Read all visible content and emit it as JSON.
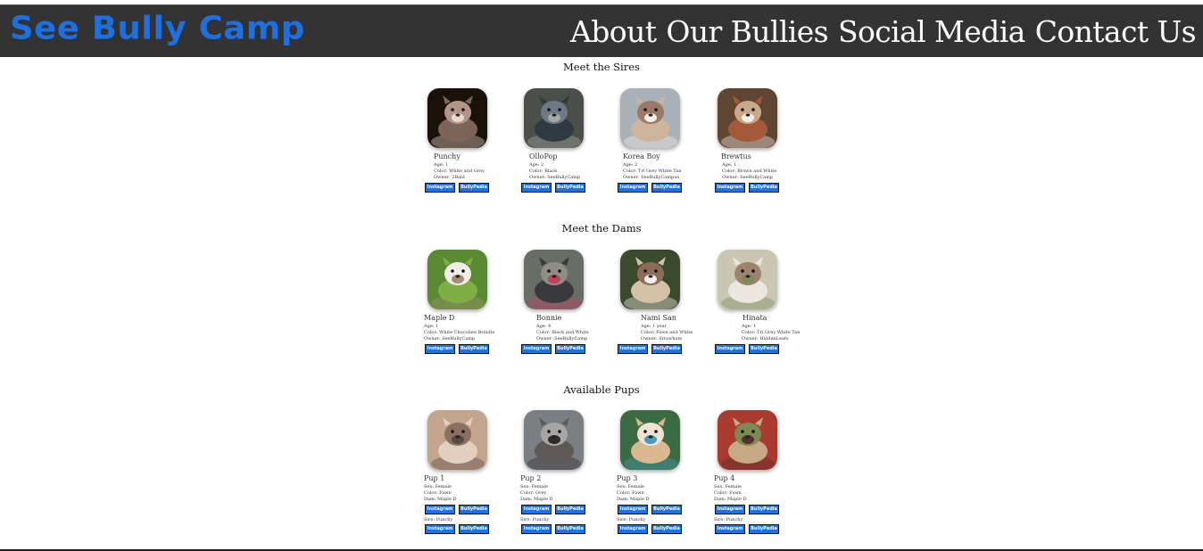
{
  "header": {
    "logo": "See Bully Camp",
    "nav": [
      "About",
      "Our Bullies",
      "Social Media",
      "Contact Us"
    ]
  },
  "sections": {
    "sires": {
      "title": "Meet the Sires",
      "dogs": [
        {
          "name": "Punchy",
          "lines": [
            "Age: 1",
            "Color: White and Grey",
            "Owner: 2Baid"
          ]
        },
        {
          "name": "OlloPop",
          "lines": [
            "Age: 2",
            "Color: Black",
            "Owner: SeeBullyCamp"
          ]
        },
        {
          "name": "Korea Boy",
          "lines": [
            "Age: 2",
            "Color: Tri Grey White Tan",
            "Owner: SeeBullyCampus"
          ]
        },
        {
          "name": "Brewtus",
          "lines": [
            "Age: 1",
            "Color: Brown and White",
            "Owner: SeeBullyCamp"
          ]
        }
      ]
    },
    "dams": {
      "title": "Meet the Dams",
      "dogs": [
        {
          "name": "Maple D",
          "lines": [
            "Age: 1",
            "Color: White Chocolate Brindle",
            "Owner: SeeBullyCamp"
          ]
        },
        {
          "name": "Bonnie",
          "lines": [
            "Age: 4",
            "Color: Black and White",
            "Owner: SeeBullyCamp"
          ]
        },
        {
          "name": "Nami San",
          "lines": [
            "Age: 1 year",
            "Color: Fawn and White",
            "Owner: Strawhats"
          ]
        },
        {
          "name": "Hinata",
          "lines": [
            "Age: 1",
            "Color: Tri Grey White Tan",
            "Owner: HiddenLeafs"
          ]
        }
      ]
    },
    "pups": {
      "title": "Available Pups",
      "dogs": [
        {
          "name": "Pup 1",
          "lines": [
            "Sex: Female",
            "Color: Fawn",
            "Dam: Maple D"
          ],
          "sire": "Sire: Punchy"
        },
        {
          "name": "Pup 2",
          "lines": [
            "Sex: Female",
            "Color: Grey",
            "Dam: Maple D"
          ],
          "sire": "Sire: Punchy"
        },
        {
          "name": "Pup 3",
          "lines": [
            "Sex: Female",
            "Color: Fawn",
            "Dam: Maple D"
          ],
          "sire": "Sire: Punchy"
        },
        {
          "name": "Pup 4",
          "lines": [
            "Sex: Female",
            "Color: Fawn",
            "Dam: Maple D"
          ],
          "sire": "Sire: Punchy"
        }
      ]
    }
  },
  "buttons": {
    "instagram": "Instagram",
    "bullypedia": "BullyPedia"
  },
  "colors": {
    "header_bg": "#333333",
    "logo": "#1e6fe0",
    "button": "#1a73e8"
  }
}
